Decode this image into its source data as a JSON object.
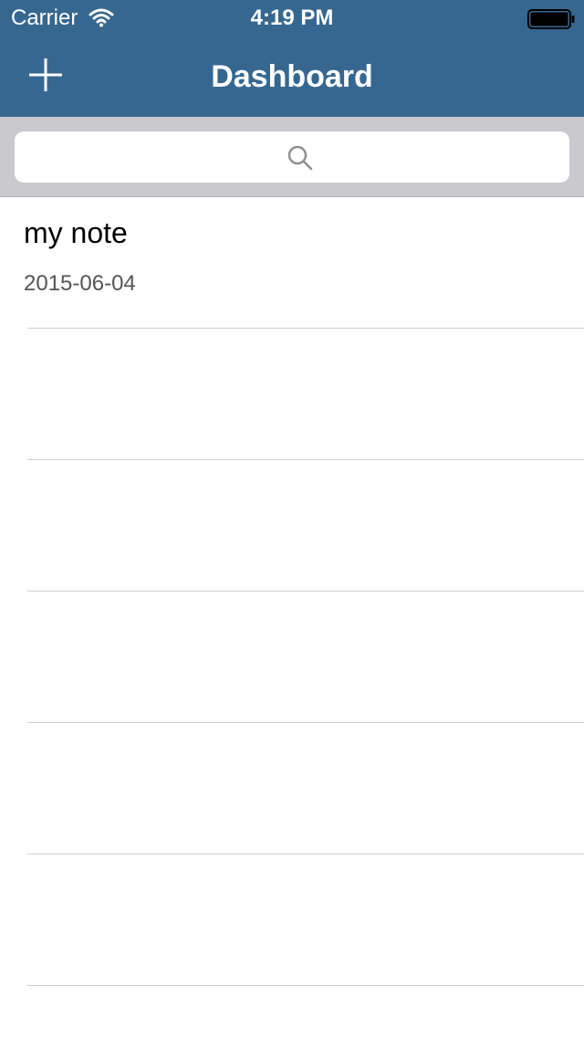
{
  "status_bar": {
    "carrier": "Carrier",
    "time": "4:19 PM"
  },
  "nav": {
    "title": "Dashboard",
    "add_icon": "plus-icon"
  },
  "search": {
    "placeholder": "",
    "icon": "search-icon"
  },
  "notes": [
    {
      "title": "my note",
      "date": "2015-06-04"
    }
  ],
  "colors": {
    "header_bg": "#366790",
    "search_bar_bg": "#c9c9ce",
    "separator": "#cfcfd3"
  }
}
